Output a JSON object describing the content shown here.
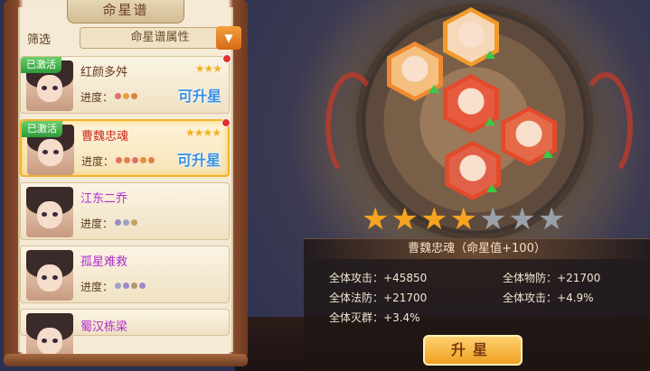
{
  "panel": {
    "title": "命星谱",
    "filter_label": "筛选",
    "filter_value": "命星谱属性",
    "filter_arrow_icon": "chevron-down-icon"
  },
  "list": [
    {
      "name": "红颜多舛",
      "name_color": "#6a3a20",
      "active_label": "已激活",
      "active": true,
      "stars": "★★★",
      "has_dot": true,
      "progress_label": "进度：",
      "dots": [
        "#e07060",
        "#e0a040",
        "#e08040"
      ],
      "upgrade": "可升星"
    },
    {
      "name": "曹魏忠魂",
      "name_color": "#c8281e",
      "active_label": "已激活",
      "active": true,
      "stars": "★★★★",
      "has_dot": true,
      "progress_label": "进度：",
      "dots": [
        "#e07060",
        "#e08050",
        "#e07060",
        "#e09040",
        "#e08040"
      ],
      "upgrade": "可升星"
    },
    {
      "name": "江东二乔",
      "name_color": "#b02ad0",
      "active": false,
      "stars": "",
      "has_dot": false,
      "progress_label": "进度：",
      "dots": [
        "#9a8ac8",
        "#9aa2c8",
        "#c6a060"
      ],
      "upgrade": ""
    },
    {
      "name": "孤星难救",
      "name_color": "#b02ad0",
      "active": false,
      "stars": "",
      "has_dot": false,
      "progress_label": "进度：",
      "dots": [
        "#9aa2c8",
        "#9a8ac8",
        "#b09870",
        "#9a8ac8"
      ],
      "upgrade": ""
    },
    {
      "name": "蜀汉栋梁",
      "name_color": "#b02ad0",
      "active": false,
      "stars": "",
      "has_dot": false,
      "progress_label": "",
      "dots": [],
      "upgrade": ""
    }
  ],
  "stars_row": {
    "lit": 4,
    "total": 7,
    "lit_color": "#f6a420",
    "dim_color": "#9aa0a8"
  },
  "info": {
    "title": "曹魏忠魂（命星值+100）",
    "stats": [
      {
        "label": "全体攻击：",
        "value": "+45850"
      },
      {
        "label": "全体物防：",
        "value": "+21700"
      },
      {
        "label": "全体法防：",
        "value": "+21700"
      },
      {
        "label": "全体攻击：",
        "value": "+4.9%"
      },
      {
        "label": "全体灭群：",
        "value": "+3.4%"
      }
    ],
    "upgrade_button": "升星"
  },
  "hexes": [
    {
      "name": "hero-portrait-helmet",
      "ring": "#f08a30",
      "fill": "#f4c080"
    },
    {
      "name": "hero-portrait-headband",
      "ring": "#f29a2a",
      "fill": "#f6d8b8"
    },
    {
      "name": "hero-portrait-red-1",
      "ring": "#e24a2a",
      "fill": "#e85a40"
    },
    {
      "name": "hero-portrait-red-2",
      "ring": "#e24a2a",
      "fill": "#e46a48"
    },
    {
      "name": "hero-portrait-red-3",
      "ring": "#e24a2a",
      "fill": "#e06048"
    }
  ]
}
